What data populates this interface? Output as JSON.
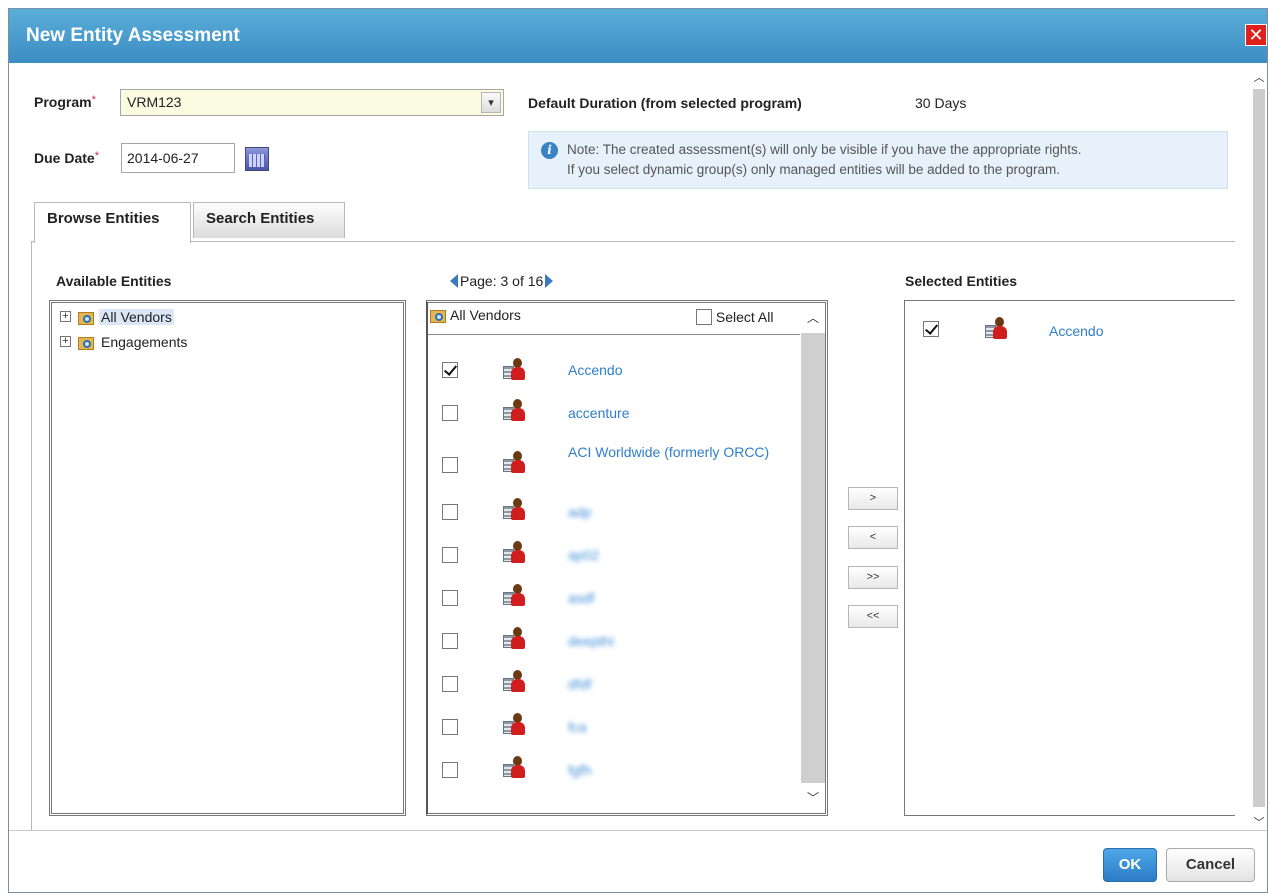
{
  "dialog": {
    "title": "New Entity Assessment",
    "close_glyph": "✕"
  },
  "form": {
    "program_label": "Program",
    "program_required": "*",
    "program_value": "VRM123",
    "due_date_label": "Due Date",
    "due_date_required": "*",
    "due_date_value": "2014-06-27",
    "duration_label": "Default Duration (from selected program)",
    "duration_value": "30 Days",
    "note_line1": "Note: The created assessment(s) will only be visible if you have the appropriate rights.",
    "note_line2": "If you select dynamic group(s) only managed entities will be added to the program."
  },
  "tabs": [
    {
      "label": "Browse Entities",
      "active": true
    },
    {
      "label": "Search Entities",
      "active": false
    }
  ],
  "available": {
    "title": "Available Entities",
    "pager": "Page: 3 of 16",
    "tree": [
      {
        "label": "All Vendors",
        "selected": true
      },
      {
        "label": "Engagements",
        "selected": false
      }
    ],
    "list_header": "All Vendors",
    "select_all_label": "Select All",
    "items": [
      {
        "name": "Accendo",
        "checked": true,
        "blurred": false
      },
      {
        "name": "accenture",
        "checked": false,
        "blurred": false
      },
      {
        "name": "ACI Worldwide (formerly ORCC)",
        "checked": false,
        "blurred": false
      },
      {
        "name": "adp",
        "checked": false,
        "blurred": true
      },
      {
        "name": "ap02",
        "checked": false,
        "blurred": true
      },
      {
        "name": "asdf",
        "checked": false,
        "blurred": true
      },
      {
        "name": "deepthi",
        "checked": false,
        "blurred": true
      },
      {
        "name": "dfdf",
        "checked": false,
        "blurred": true
      },
      {
        "name": "fca",
        "checked": false,
        "blurred": true
      },
      {
        "name": "fgfh",
        "checked": false,
        "blurred": true
      }
    ]
  },
  "move_buttons": [
    ">",
    "<",
    ">>",
    "<<"
  ],
  "selected": {
    "title": "Selected Entities",
    "items": [
      {
        "name": "Accendo",
        "checked": true
      }
    ]
  },
  "footer": {
    "ok_label": "OK",
    "cancel_label": "Cancel"
  },
  "icons": {
    "folder": "folder-search-icon",
    "entity": "vendor-person-icon",
    "calendar": "calendar-icon",
    "info": "info-icon"
  },
  "colors": {
    "title_bar": "#3c8dc3",
    "link": "#2f7ec9",
    "ok_button": "#2b7cc4",
    "close": "#e0201b"
  }
}
